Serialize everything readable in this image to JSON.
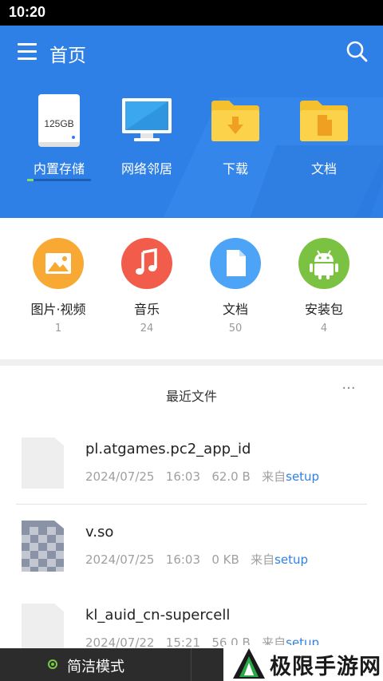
{
  "status_bar": {
    "time": "10:20"
  },
  "header": {
    "title": "首页",
    "storage_items": [
      {
        "label": "内置存储",
        "capacity": "125GB",
        "icon": "drive-icon",
        "usage_fraction": 0.1
      },
      {
        "label": "网络邻居",
        "icon": "monitor-icon"
      },
      {
        "label": "下载",
        "icon": "download-folder-icon"
      },
      {
        "label": "文档",
        "icon": "document-folder-icon"
      }
    ]
  },
  "categories": [
    {
      "label": "图片·视频",
      "count": "1",
      "icon": "image-icon",
      "color": "#f7a934"
    },
    {
      "label": "音乐",
      "count": "24",
      "icon": "music-icon",
      "color": "#f25c4a"
    },
    {
      "label": "文档",
      "count": "50",
      "icon": "document-icon",
      "color": "#4da3f5"
    },
    {
      "label": "安装包",
      "count": "4",
      "icon": "android-icon",
      "color": "#7cc242"
    }
  ],
  "recent": {
    "title": "最近文件",
    "more": "···",
    "files": [
      {
        "name": "pl.atgames.pc2_app_id",
        "date": "2024/07/25",
        "time": "16:03",
        "size": "62.0 B",
        "from": "来自",
        "source": "setup"
      },
      {
        "name": "v.so",
        "date": "2024/07/25",
        "time": "16:03",
        "size": "0 KB",
        "from": "来自",
        "source": "setup"
      },
      {
        "name": "kl_auid_cn-supercell",
        "date": "2024/07/22",
        "time": "15:21",
        "size": "56.0 B",
        "from": "来自",
        "source": "setup"
      }
    ]
  },
  "bottom_bar": {
    "simple_mode": "简洁模式"
  },
  "watermark": {
    "text": "极限手游网"
  },
  "colors": {
    "accent": "#2f80e6",
    "header_bg": "#2f80e6",
    "usage_fill": "#7ee06a"
  }
}
